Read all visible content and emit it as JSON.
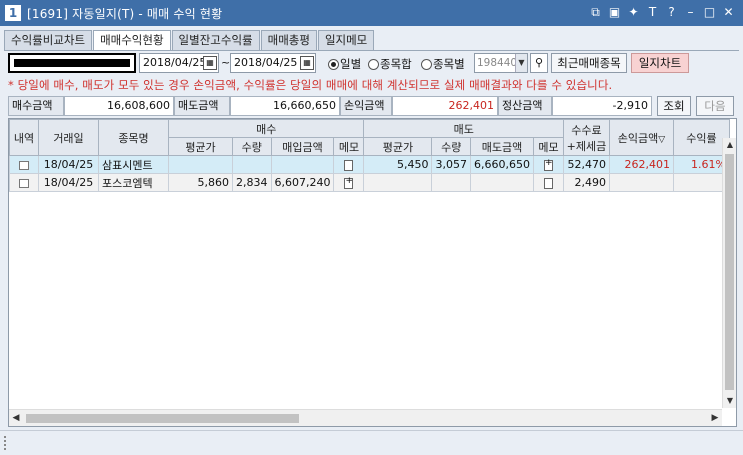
{
  "window": {
    "app_icon": "1",
    "title": "[1691] 자동일지(T) - 매매 수익 현황",
    "controls": [
      "restore-pair-icon",
      "tile-icon",
      "pin-icon",
      "font-size-icon",
      "help-icon",
      "minimize-icon",
      "maximize-icon",
      "close-icon"
    ]
  },
  "tabs": [
    {
      "label": "수익률비교차트",
      "active": false
    },
    {
      "label": "매매수익현황",
      "active": true
    },
    {
      "label": "일별잔고수익률",
      "active": false
    },
    {
      "label": "매매총평",
      "active": false
    },
    {
      "label": "일지메모",
      "active": false
    }
  ],
  "toolbar": {
    "date_from": "2018/04/25",
    "tilde": "~",
    "date_to": "2018/04/25",
    "radio_daily": "일별",
    "radio_stock_sum": "종목합",
    "radio_by_stock": "종목별",
    "stock_code": "198440",
    "recent_trade_label": "최근매매종목",
    "journal_chart_label": "일지차트"
  },
  "notice": "* 당일에 매수, 매도가 모두 있는 경우 손익금액, 수익률은 당일의 매매에 대해 계산되므로 실제 매매결과와 다를 수 있습니다.",
  "summary": {
    "buy_amount_label": "매수금액",
    "buy_amount": "16,608,600",
    "sell_amount_label": "매도금액",
    "sell_amount": "16,660,650",
    "pnl_label": "손익금액",
    "pnl": "262,401",
    "settle_label": "정산금액",
    "settle": "-2,910",
    "query_label": "조회",
    "next_label": "다음"
  },
  "grid": {
    "headers": {
      "detail": "내역",
      "date": "거래일",
      "name": "종목명",
      "buy_group": "매수",
      "sell_group": "매도",
      "fee": "수수료",
      "fee_tax": "+제세금",
      "pnl": "손익금액",
      "rate": "수익률",
      "buy_avg": "평균가",
      "buy_qty": "수량",
      "buy_amount": "매입금액",
      "buy_memo": "메모",
      "sell_avg": "평균가",
      "sell_qty": "수량",
      "sell_amount": "매도금액",
      "sell_memo": "메모"
    },
    "rows": [
      {
        "date": "18/04/25",
        "name": "삼표시멘트",
        "buy_avg": "",
        "buy_qty": "",
        "buy_amount": "",
        "sell_avg": "5,450",
        "sell_qty": "3,057",
        "sell_amount": "6,660,650",
        "fee": "52,470",
        "pnl": "262,401",
        "rate": "1.61%"
      },
      {
        "date": "18/04/25",
        "name": "포스코엠텍",
        "buy_avg": "5,860",
        "buy_qty": "2,834",
        "buy_amount": "6,607,240",
        "sell_avg": "",
        "sell_qty": "",
        "sell_amount": "",
        "fee": "2,490",
        "pnl": "",
        "rate": ""
      }
    ]
  },
  "colors": {
    "titlebar": "#3f6fa8",
    "accent_red": "#c8261f",
    "selected_row": "#d4ecf7"
  }
}
